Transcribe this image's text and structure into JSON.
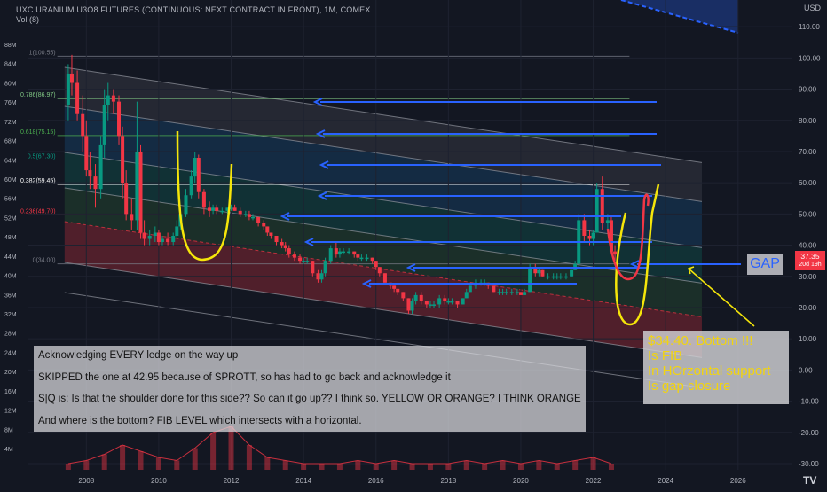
{
  "header": {
    "title": "UXC URANIUM U3O8 FUTURES (CONTINUOUS: NEXT CONTRACT IN FRONT), 1M, COMEX",
    "vol_label": "Vol (8)",
    "currency": "USD"
  },
  "chart_data": {
    "type": "candlestick",
    "x_axis": {
      "tick_labels": [
        "2008",
        "2010",
        "2012",
        "2014",
        "2016",
        "2018",
        "2020",
        "2022",
        "2024",
        "2026"
      ],
      "range": [
        2006.4,
        2027.5
      ]
    },
    "y_axis_right": {
      "tick_labels": [
        "110.00",
        "100.00",
        "90.00",
        "80.00",
        "70.00",
        "60.00",
        "50.00",
        "40.00",
        "30.00",
        "20.00",
        "10.00",
        "0.00",
        "-10.00",
        "-20.00",
        "-30.00"
      ],
      "range": [
        -32,
        118
      ]
    },
    "volume_axis_left": {
      "tick_labels": [
        "88M",
        "84M",
        "80M",
        "76M",
        "72M",
        "68M",
        "64M",
        "60M",
        "56M",
        "52M",
        "48M",
        "44M",
        "40M",
        "36M",
        "32M",
        "28M",
        "24M",
        "20M",
        "16M",
        "12M",
        "8M",
        "4M"
      ]
    },
    "last_price": {
      "value": "37.35",
      "countdown": "20d 19h"
    },
    "series": [
      {
        "type": "candles",
        "ohlc": [
          [
            2007.5,
            85,
            98,
            80,
            95
          ],
          [
            2007.6,
            95,
            101,
            88,
            92
          ],
          [
            2007.75,
            92,
            96,
            80,
            82
          ],
          [
            2007.9,
            82,
            88,
            70,
            75
          ],
          [
            2008.0,
            75,
            80,
            62,
            64
          ],
          [
            2008.1,
            64,
            70,
            58,
            62
          ],
          [
            2008.25,
            62,
            66,
            52,
            58
          ],
          [
            2008.4,
            58,
            75,
            55,
            72
          ],
          [
            2008.5,
            72,
            90,
            68,
            85
          ],
          [
            2008.6,
            85,
            92,
            80,
            88
          ],
          [
            2008.75,
            88,
            90,
            82,
            86
          ],
          [
            2008.9,
            86,
            88,
            72,
            75
          ],
          [
            2009.0,
            75,
            78,
            55,
            60
          ],
          [
            2009.1,
            60,
            64,
            48,
            50
          ],
          [
            2009.25,
            50,
            55,
            45,
            48
          ],
          [
            2009.4,
            48,
            86,
            45,
            70
          ],
          [
            2009.5,
            70,
            72,
            42,
            44
          ],
          [
            2009.6,
            44,
            48,
            40,
            42
          ],
          [
            2009.75,
            42,
            45,
            40,
            43
          ],
          [
            2009.9,
            43,
            46,
            41,
            44
          ],
          [
            2010.0,
            44,
            45,
            40,
            41
          ],
          [
            2010.1,
            41,
            43,
            40,
            42
          ],
          [
            2010.25,
            42,
            44,
            40,
            41
          ],
          [
            2010.4,
            41,
            44,
            40,
            43
          ],
          [
            2010.5,
            43,
            48,
            42,
            46
          ],
          [
            2010.6,
            46,
            52,
            45,
            50
          ],
          [
            2010.75,
            50,
            58,
            49,
            56
          ],
          [
            2010.9,
            56,
            64,
            55,
            62
          ],
          [
            2011.0,
            62,
            70,
            60,
            68
          ],
          [
            2011.1,
            68,
            69,
            55,
            57
          ],
          [
            2011.25,
            57,
            58,
            50,
            52
          ],
          [
            2011.4,
            52,
            54,
            49,
            51
          ],
          [
            2011.5,
            51,
            53,
            50,
            52
          ],
          [
            2011.6,
            52,
            53,
            50,
            51
          ],
          [
            2011.75,
            51,
            52,
            50,
            51
          ],
          [
            2011.9,
            51,
            52,
            50,
            52
          ],
          [
            2012.0,
            52,
            53,
            51,
            52
          ],
          [
            2012.1,
            52,
            53,
            51,
            51
          ],
          [
            2012.25,
            51,
            52,
            49,
            50
          ],
          [
            2012.4,
            50,
            51,
            49,
            50
          ],
          [
            2012.5,
            50,
            51,
            48,
            49
          ],
          [
            2012.6,
            49,
            50,
            48,
            49
          ],
          [
            2012.75,
            49,
            49,
            46,
            47
          ],
          [
            2012.9,
            47,
            48,
            45,
            46
          ],
          [
            2013.0,
            46,
            46,
            43,
            44
          ],
          [
            2013.1,
            44,
            44,
            42,
            43
          ],
          [
            2013.25,
            43,
            43,
            40,
            41
          ],
          [
            2013.4,
            41,
            42,
            39,
            40
          ],
          [
            2013.5,
            40,
            41,
            38,
            39
          ],
          [
            2013.6,
            39,
            40,
            36,
            37
          ],
          [
            2013.75,
            37,
            38,
            35,
            36
          ],
          [
            2013.9,
            36,
            37,
            34,
            35
          ],
          [
            2014.0,
            35,
            36,
            34,
            35
          ],
          [
            2014.1,
            35,
            36,
            34,
            35
          ],
          [
            2014.25,
            35,
            35,
            30,
            31
          ],
          [
            2014.4,
            31,
            32,
            28,
            29
          ],
          [
            2014.5,
            29,
            32,
            28,
            31
          ],
          [
            2014.6,
            31,
            36,
            30,
            35
          ],
          [
            2014.75,
            35,
            40,
            34,
            39
          ],
          [
            2014.9,
            39,
            41,
            36,
            37
          ],
          [
            2015.0,
            37,
            39,
            36,
            38
          ],
          [
            2015.1,
            38,
            39,
            37,
            38
          ],
          [
            2015.25,
            38,
            39,
            37,
            38
          ],
          [
            2015.4,
            38,
            38,
            36,
            37
          ],
          [
            2015.5,
            37,
            37,
            35,
            36
          ],
          [
            2015.6,
            36,
            37,
            35,
            36
          ],
          [
            2015.75,
            36,
            37,
            35,
            36
          ],
          [
            2015.9,
            36,
            36,
            34,
            35
          ],
          [
            2016.0,
            35,
            35,
            32,
            33
          ],
          [
            2016.1,
            33,
            33,
            30,
            31
          ],
          [
            2016.25,
            31,
            31,
            28,
            28
          ],
          [
            2016.4,
            28,
            28,
            26,
            27
          ],
          [
            2016.5,
            27,
            27,
            25,
            26
          ],
          [
            2016.6,
            26,
            26,
            24,
            25
          ],
          [
            2016.75,
            25,
            25,
            22,
            23
          ],
          [
            2016.9,
            23,
            23,
            18,
            19
          ],
          [
            2017.0,
            19,
            23,
            18,
            22
          ],
          [
            2017.1,
            22,
            25,
            21,
            24
          ],
          [
            2017.25,
            24,
            25,
            21,
            22
          ],
          [
            2017.4,
            22,
            22,
            20,
            21
          ],
          [
            2017.5,
            21,
            22,
            20,
            21
          ],
          [
            2017.6,
            21,
            22,
            20,
            21
          ],
          [
            2017.75,
            21,
            24,
            20,
            23
          ],
          [
            2017.9,
            23,
            24,
            21,
            22
          ],
          [
            2018.0,
            22,
            23,
            21,
            22
          ],
          [
            2018.1,
            22,
            23,
            21,
            22
          ],
          [
            2018.25,
            22,
            22,
            20,
            21
          ],
          [
            2018.4,
            21,
            23,
            21,
            23
          ],
          [
            2018.5,
            23,
            26,
            23,
            25
          ],
          [
            2018.6,
            25,
            27,
            25,
            27
          ],
          [
            2018.75,
            27,
            29,
            26,
            28
          ],
          [
            2018.9,
            28,
            29,
            27,
            28
          ],
          [
            2019.0,
            28,
            29,
            27,
            28
          ],
          [
            2019.1,
            28,
            28,
            26,
            27
          ],
          [
            2019.25,
            27,
            27,
            25,
            25
          ],
          [
            2019.4,
            25,
            26,
            24,
            25
          ],
          [
            2019.5,
            25,
            26,
            24,
            25
          ],
          [
            2019.6,
            25,
            26,
            24,
            25
          ],
          [
            2019.75,
            25,
            26,
            24,
            25
          ],
          [
            2019.9,
            25,
            26,
            24,
            25
          ],
          [
            2020.0,
            25,
            25,
            24,
            24
          ],
          [
            2020.1,
            24,
            26,
            24,
            25
          ],
          [
            2020.25,
            25,
            34,
            25,
            33
          ],
          [
            2020.4,
            33,
            34,
            30,
            31
          ],
          [
            2020.5,
            31,
            33,
            30,
            32
          ],
          [
            2020.6,
            32,
            32,
            30,
            30
          ],
          [
            2020.75,
            30,
            31,
            29,
            30
          ],
          [
            2020.9,
            30,
            31,
            29,
            30
          ],
          [
            2021.0,
            30,
            31,
            29,
            30
          ],
          [
            2021.1,
            30,
            31,
            29,
            30
          ],
          [
            2021.25,
            30,
            31,
            29,
            30
          ],
          [
            2021.4,
            30,
            32,
            30,
            32
          ],
          [
            2021.5,
            32,
            35,
            32,
            34
          ],
          [
            2021.6,
            34,
            50,
            33,
            48
          ],
          [
            2021.75,
            48,
            50,
            41,
            43
          ],
          [
            2021.9,
            43,
            45,
            40,
            42
          ],
          [
            2022.0,
            42,
            45,
            40,
            44
          ],
          [
            2022.1,
            44,
            60,
            44,
            58
          ],
          [
            2022.25,
            58,
            62,
            45,
            47
          ],
          [
            2022.4,
            47,
            50,
            44,
            48
          ],
          [
            2022.5,
            48,
            49,
            37,
            38
          ],
          [
            2022.6,
            38,
            40,
            35,
            37
          ]
        ]
      },
      {
        "type": "volume",
        "x": [
          2007.5,
          2008.0,
          2008.5,
          2009.0,
          2009.5,
          2010.0,
          2010.5,
          2011.0,
          2011.5,
          2012.0,
          2012.5,
          2013.0,
          2013.5,
          2014.0,
          2014.5,
          2015.0,
          2015.5,
          2016.0,
          2016.5,
          2017.0,
          2017.5,
          2018.0,
          2018.5,
          2019.0,
          2019.5,
          2020.0,
          2020.5,
          2021.0,
          2021.5,
          2022.0,
          2022.5
        ],
        "values": [
          2,
          3,
          5,
          8,
          6,
          4,
          3,
          7,
          12,
          14,
          8,
          4,
          3,
          2,
          2,
          2,
          3,
          2,
          3,
          2,
          2,
          2,
          3,
          2,
          3,
          2,
          3,
          2,
          3,
          4,
          2
        ]
      }
    ],
    "fib_levels": [
      {
        "label": "1(100.55)",
        "value": 100.55,
        "color": "#787b86"
      },
      {
        "label": "0.786(86.97)",
        "value": 86.97,
        "color": "#81c784"
      },
      {
        "label": "0.618(75.15)",
        "value": 75.15,
        "color": "#4caf50"
      },
      {
        "label": "0.5(67.30)",
        "value": 67.3,
        "color": "#089981"
      },
      {
        "label": "0.382(59.45)",
        "value": 59.45,
        "color": "#ffffff"
      },
      {
        "label": "0.236(49.70)",
        "value": 49.7,
        "color": "#f23645"
      },
      {
        "label": "0(34.00)",
        "value": 34.0,
        "color": "#787b86"
      }
    ]
  },
  "annotations": {
    "notes": [
      "Acknowledging EVERY ledge on the way up",
      "SKIPPED the one at 42.95 because of SPROTT, so has had to go back and acknowledge it",
      "S|Q is: Is that the shoulder done for this side?? So can it go up?? I think so. YELLOW OR ORANGE? I THINK ORANGE",
      "And where is the bottom? FIB LEVEL which intersects with a horizontal."
    ],
    "callout": [
      "$34.40. Bottom !!!",
      "Is FIB",
      "In HOrzontal support",
      "Is gap closure"
    ],
    "gap_label": "GAP"
  },
  "colors": {
    "background": "#131722",
    "candle_up": "#089981",
    "candle_down": "#f23645",
    "arrow_blue": "#2962ff",
    "marker_yellow": "#f5e60a",
    "marker_red": "#f23645"
  },
  "logo": {
    "text": "TV"
  }
}
